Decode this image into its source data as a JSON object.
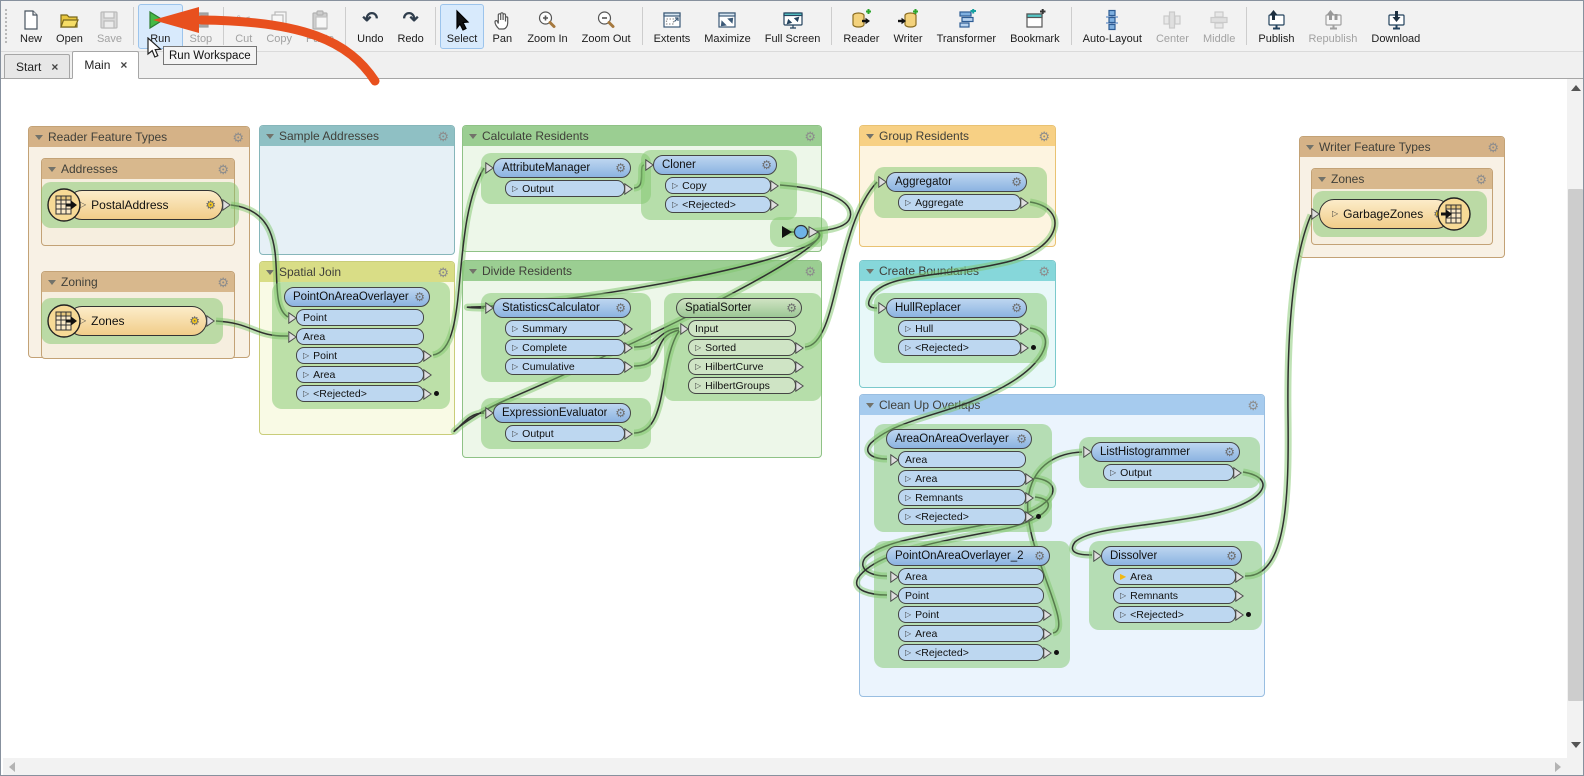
{
  "toolbar": {
    "groups": [
      {
        "items": [
          {
            "id": "new",
            "label": "New",
            "icon": "new-file"
          },
          {
            "id": "open",
            "label": "Open",
            "icon": "open-folder"
          },
          {
            "id": "save",
            "label": "Save",
            "icon": "save-floppy",
            "disabled": true
          }
        ]
      },
      {
        "items": [
          {
            "id": "run",
            "label": "Run",
            "icon": "run-play",
            "highlight": true,
            "dropdown": true
          },
          {
            "id": "stop",
            "label": "Stop",
            "icon": "stop-square",
            "disabled": true
          }
        ]
      },
      {
        "items": [
          {
            "id": "cut",
            "label": "Cut",
            "icon": "cut-scissors",
            "disabled": true
          },
          {
            "id": "copy",
            "label": "Copy",
            "icon": "copy-pages",
            "disabled": true
          },
          {
            "id": "paste",
            "label": "Paste",
            "icon": "paste-clipboard",
            "disabled": true
          }
        ]
      },
      {
        "items": [
          {
            "id": "undo",
            "label": "Undo",
            "icon": "undo-arrow"
          },
          {
            "id": "redo",
            "label": "Redo",
            "icon": "redo-arrow"
          }
        ]
      },
      {
        "items": [
          {
            "id": "select",
            "label": "Select",
            "icon": "select-cursor",
            "highlight": true
          },
          {
            "id": "pan",
            "label": "Pan",
            "icon": "pan-hand"
          },
          {
            "id": "zoomin",
            "label": "Zoom In",
            "icon": "zoom-in"
          },
          {
            "id": "zoomout",
            "label": "Zoom Out",
            "icon": "zoom-out"
          }
        ]
      },
      {
        "items": [
          {
            "id": "extents",
            "label": "Extents",
            "icon": "extents-window"
          },
          {
            "id": "maximize",
            "label": "Maximize",
            "icon": "maximize-window"
          },
          {
            "id": "fullscreen",
            "label": "Full Screen",
            "icon": "full-screen"
          }
        ]
      },
      {
        "items": [
          {
            "id": "reader",
            "label": "Reader",
            "icon": "reader-db"
          },
          {
            "id": "writer",
            "label": "Writer",
            "icon": "writer-db"
          },
          {
            "id": "transformer",
            "label": "Transformer",
            "icon": "transformer-bars"
          },
          {
            "id": "bookmark",
            "label": "Bookmark",
            "icon": "bookmark-window"
          }
        ]
      },
      {
        "items": [
          {
            "id": "autolayout",
            "label": "Auto-Layout",
            "icon": "auto-layout"
          },
          {
            "id": "center",
            "label": "Center",
            "icon": "align-center",
            "disabled": true
          },
          {
            "id": "middle",
            "label": "Middle",
            "icon": "align-middle",
            "disabled": true
          }
        ]
      },
      {
        "items": [
          {
            "id": "publish",
            "label": "Publish",
            "icon": "publish-up"
          },
          {
            "id": "republish",
            "label": "Republish",
            "icon": "republish-up",
            "disabled": true
          },
          {
            "id": "download",
            "label": "Download",
            "icon": "download-down"
          }
        ]
      }
    ]
  },
  "tabs": {
    "close_glyph": "×",
    "items": [
      {
        "id": "start",
        "label": "Start",
        "active": false
      },
      {
        "id": "main",
        "label": "Main",
        "active": true
      }
    ]
  },
  "annotations": {
    "tooltip_text": "Run Workspace"
  },
  "colors": {
    "run_green": "#45b945",
    "highlight_blue": "#d8eafc",
    "halo_green": "rgba(127,197,107,0.5)",
    "arrow_orange": "#e8501e",
    "node_blue": "#8cb3e1",
    "node_green": "#9cc795",
    "bookmark_palette": {
      "tan": {
        "hd": "#d5b287",
        "bd": "#f8f1e5",
        "br": "#c3a276"
      },
      "tansub": {
        "hd": "#d8b88d",
        "bd": "#f6eedf",
        "br": "#c3a276"
      },
      "teal": {
        "hd": "#8fc0c4",
        "bd": "#e6f0f6",
        "br": "#86b6ba"
      },
      "lime": {
        "hd": "#d9dd86",
        "bd": "#f9fae5",
        "br": "#c9cd7a"
      },
      "green": {
        "hd": "#9bce92",
        "bd": "#edf7e9",
        "br": "#8fc286"
      },
      "orange": {
        "hd": "#f7d084",
        "bd": "#fdf4e0",
        "br": "#e9c272"
      },
      "cyan": {
        "hd": "#86d7da",
        "bd": "#e8f8f9",
        "br": "#7bc9cc"
      },
      "blue": {
        "hd": "#a6cbee",
        "bd": "#ebf4fd",
        "br": "#99bee1"
      }
    }
  },
  "canvas": {
    "bookmarks": [
      {
        "id": "rft",
        "label": "Reader Feature Types",
        "color": "tan",
        "children": [
          {
            "id": "addr",
            "label": "Addresses",
            "color": "tansub"
          },
          {
            "id": "zoning",
            "label": "Zoning",
            "color": "tansub"
          }
        ],
        "nodes": [
          {
            "id": "postal",
            "type": "reader",
            "name": "PostalAddress"
          },
          {
            "id": "zones",
            "type": "reader",
            "name": "Zones"
          }
        ]
      },
      {
        "id": "sample",
        "label": "Sample Addresses",
        "color": "teal",
        "children": [],
        "nodes": []
      },
      {
        "id": "sjoin",
        "label": "Spatial Join",
        "color": "lime",
        "children": [],
        "nodes": [
          {
            "id": "poao",
            "type": "transformer",
            "variant": "blue",
            "name": "PointOnAreaOverlayer",
            "inputs": [
              "Point",
              "Area"
            ],
            "outputs": [
              {
                "label": "Point"
              },
              {
                "label": "Area"
              },
              {
                "label": "<Rejected>",
                "dot": true
              }
            ]
          }
        ]
      },
      {
        "id": "calc",
        "label": "Calculate Residents",
        "color": "green",
        "children": [],
        "nodes": [
          {
            "id": "attrmgr",
            "type": "transformer",
            "variant": "blue",
            "name": "AttributeManager",
            "header_input": true,
            "inputs": [],
            "outputs": [
              {
                "label": "Output"
              }
            ]
          },
          {
            "id": "cloner",
            "type": "transformer",
            "variant": "blue",
            "name": "Cloner",
            "header_input": true,
            "inputs": [],
            "outputs": [
              {
                "label": "Copy"
              },
              {
                "label": "<Rejected>"
              }
            ]
          },
          {
            "id": "junction",
            "type": "junction",
            "name": ""
          }
        ]
      },
      {
        "id": "divide",
        "label": "Divide Residents",
        "color": "green",
        "children": [],
        "nodes": [
          {
            "id": "statcalc",
            "type": "transformer",
            "variant": "blue",
            "name": "StatisticsCalculator",
            "header_input": true,
            "inputs": [],
            "outputs": [
              {
                "label": "Summary"
              },
              {
                "label": "Complete"
              },
              {
                "label": "Cumulative"
              }
            ]
          },
          {
            "id": "spatialsorter",
            "type": "transformer",
            "variant": "green",
            "name": "SpatialSorter",
            "inputs": [
              "Input"
            ],
            "outputs": [
              {
                "label": "Sorted"
              },
              {
                "label": "HilbertCurve"
              },
              {
                "label": "HilbertGroups"
              }
            ]
          },
          {
            "id": "exprev",
            "type": "transformer",
            "variant": "blue",
            "name": "ExpressionEvaluator",
            "header_input": true,
            "inputs": [],
            "outputs": [
              {
                "label": "Output"
              }
            ]
          }
        ]
      },
      {
        "id": "group",
        "label": "Group Residents",
        "color": "orange",
        "children": [],
        "nodes": [
          {
            "id": "aggregator",
            "type": "transformer",
            "variant": "blue",
            "name": "Aggregator",
            "header_input": true,
            "inputs": [],
            "outputs": [
              {
                "label": "Aggregate"
              }
            ]
          }
        ]
      },
      {
        "id": "bounds",
        "label": "Create Boundaries",
        "color": "cyan",
        "children": [],
        "nodes": [
          {
            "id": "hullrep",
            "type": "transformer",
            "variant": "blue",
            "name": "HullReplacer",
            "header_input": true,
            "inputs": [],
            "outputs": [
              {
                "label": "Hull"
              },
              {
                "label": "<Rejected>",
                "dot": true
              }
            ]
          }
        ]
      },
      {
        "id": "cleanup",
        "label": "Clean Up Overlaps",
        "color": "blue",
        "children": [],
        "nodes": [
          {
            "id": "aoao",
            "type": "transformer",
            "variant": "blue",
            "name": "AreaOnAreaOverlayer",
            "inputs": [
              "Area"
            ],
            "outputs": [
              {
                "label": "Area"
              },
              {
                "label": "Remnants"
              },
              {
                "label": "<Rejected>",
                "dot": true
              }
            ]
          },
          {
            "id": "listhist",
            "type": "transformer",
            "variant": "blue",
            "name": "ListHistogrammer",
            "header_input": true,
            "inputs": [],
            "outputs": [
              {
                "label": "Output"
              }
            ]
          },
          {
            "id": "poao2",
            "type": "transformer",
            "variant": "blue",
            "name": "PointOnAreaOverlayer_2",
            "inputs": [
              "Area",
              "Point"
            ],
            "outputs": [
              {
                "label": "Point"
              },
              {
                "label": "Area"
              },
              {
                "label": "<Rejected>",
                "dot": true
              }
            ]
          },
          {
            "id": "dissolver",
            "type": "transformer",
            "variant": "blue",
            "name": "Dissolver",
            "header_input": true,
            "inputs": [],
            "outputs": [
              {
                "label": "Area",
                "yellow": true
              },
              {
                "label": "Remnants"
              },
              {
                "label": "<Rejected>",
                "dot": true
              }
            ]
          }
        ]
      },
      {
        "id": "wft",
        "label": "Writer Feature Types",
        "color": "tan",
        "children": [
          {
            "id": "zonesbm",
            "label": "Zones",
            "color": "tansub"
          }
        ],
        "nodes": [
          {
            "id": "garbage",
            "type": "writer",
            "name": "GarbageZones"
          }
        ]
      }
    ]
  }
}
